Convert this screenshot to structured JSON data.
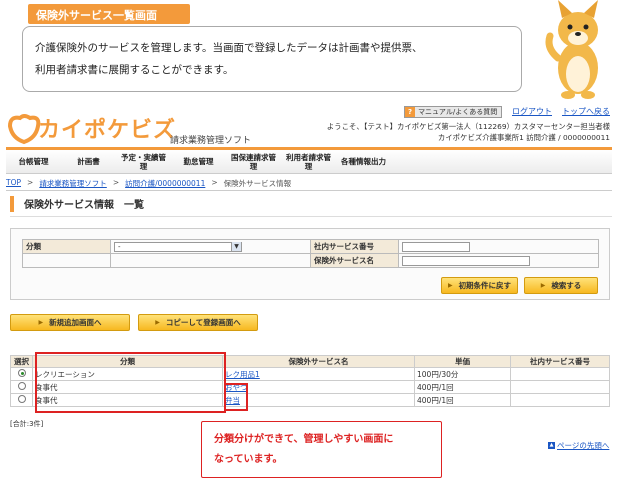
{
  "tutorial": {
    "title": "保険外サービス一覧画面",
    "line1": "介護保険外のサービスを管理します。当画面で登録したデータは計画書や提供票、",
    "line2": "利用者請求書に展開することができます。",
    "callout_line1": "分類分けができて、管理しやすい画面に",
    "callout_line2": "なっています。"
  },
  "header": {
    "logo_text": "カイポケビズ",
    "app_name": "請求業務管理ソフト",
    "help_label": "マニュアル/よくある質問",
    "logout_label": "ログアウト",
    "top_label": "トップへ戻る",
    "welcome_line1": "ようこそ、【テスト】カイポケビズ第一法人（112269）カスタマーセンター担当者様",
    "welcome_line2": "カイポケビズ介護事業所1 訪問介護 / 0000000011"
  },
  "nav": [
    "台帳管理",
    "計画書",
    "予定・実績管理",
    "勤怠管理",
    "国保連請求管理",
    "利用者請求管理",
    "各種情報出力"
  ],
  "breadcrumb": {
    "top": "TOP",
    "soft": "請求業務管理ソフト",
    "office": "訪問介護/0000000011",
    "current": "保険外サービス情報"
  },
  "page_title": "保険外サービス情報　一覧",
  "search": {
    "category_label": "分類",
    "category_value": "-",
    "internal_no_label": "社内サービス番号",
    "service_name_label": "保険外サービス名",
    "reset_button": "初期条件に戻す",
    "search_button": "検索する"
  },
  "actions": {
    "new_button": "新規追加画面へ",
    "copy_button": "コピーして登録画面へ"
  },
  "results": {
    "headers": [
      "選択",
      "分類",
      "保険外サービス名",
      "単価",
      "社内サービス番号"
    ],
    "rows": [
      {
        "category": "レクリエーション",
        "name": "レク用品1",
        "price": "100円/30分",
        "no": "",
        "selected": true
      },
      {
        "category": "食事代",
        "name": "おやつ",
        "price": "400円/1回",
        "no": "",
        "selected": false
      },
      {
        "category": "食事代",
        "name": "弁当",
        "price": "400円/1回",
        "no": "",
        "selected": false
      }
    ],
    "count": "[合計:3件]"
  },
  "page_top": "ページの先頭へ",
  "colors": {
    "accent": "#f39a3b",
    "highlight": "#dd2222",
    "link": "#1a56c4"
  }
}
